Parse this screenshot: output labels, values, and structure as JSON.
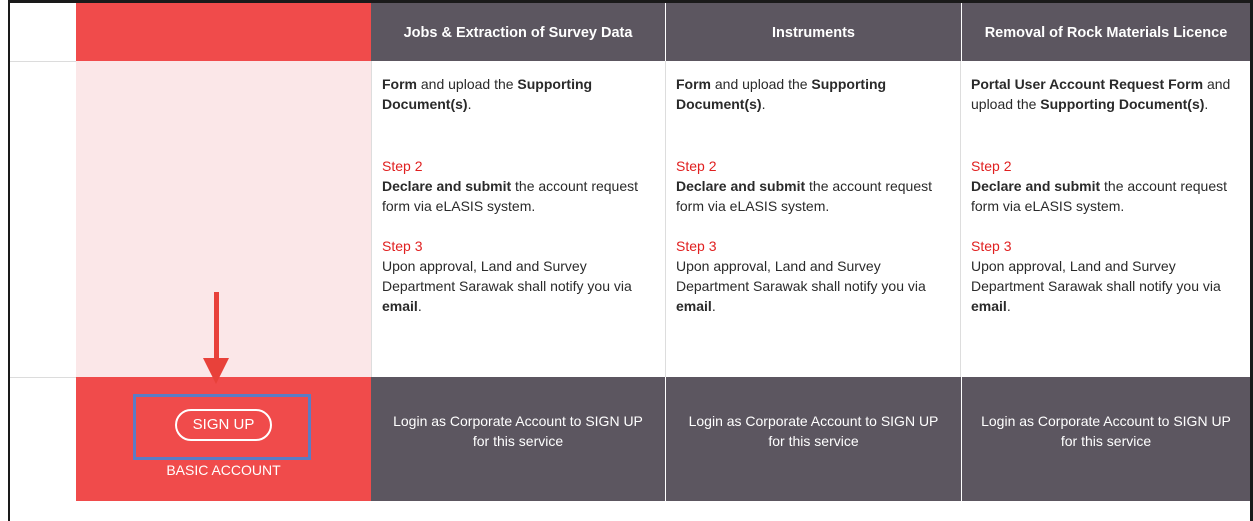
{
  "columns": [
    {
      "header_partial": "",
      "header": "Jobs & Extraction of Survey Data",
      "body_partial": "",
      "form_bold": "Form",
      "form_text1": " and upload the ",
      "form_bold2": "Supporting Document(s)",
      "form_text2": ".",
      "step2_title": "Step 2",
      "step2_bold": "Declare and submit",
      "step2_text": " the account request form via eLASIS system.",
      "step3_title": "Step 3",
      "step3_text": "Upon approval, Land and Survey Department Sarawak shall notify you via ",
      "step3_bold": "email",
      "step3_end": ".",
      "footer": "Login as Corporate Account to SIGN UP for this service"
    },
    {
      "header_partial": "",
      "header": "Instruments",
      "body_partial": "",
      "form_bold": "Form",
      "form_text1": " and upload the ",
      "form_bold2": "Supporting Document(s)",
      "form_text2": ".",
      "step2_title": "Step 2",
      "step2_bold": "Declare and submit",
      "step2_text": " the account request form via eLASIS system.",
      "step3_title": "Step 3",
      "step3_text": "Upon approval, Land and Survey Department Sarawak shall notify you via ",
      "step3_bold": "email",
      "step3_end": ".",
      "footer": "Login as Corporate Account to SIGN UP for this service"
    },
    {
      "header_partial": "",
      "header": "Removal of Rock Materials Licence",
      "body_partial": "",
      "form_bold": "Portal User Account Request Form",
      "form_text1": " and upload the ",
      "form_bold2": "Supporting Document(s)",
      "form_text2": ".",
      "step2_title": "Step 2",
      "step2_bold": "Declare and submit",
      "step2_text": " the account request form via eLASIS system.",
      "step3_title": "Step 3",
      "step3_text": "Upon approval, Land and Survey Department Sarawak shall notify you via ",
      "step3_bold": "email",
      "step3_end": ".",
      "footer": "Login as Corporate Account to SIGN UP for this service"
    }
  ],
  "basic": {
    "signup_label": "SIGN UP",
    "account_label": "BASIC ACCOUNT"
  },
  "colors": {
    "red": "#f04b4b",
    "pink": "#fbe7e8",
    "dark": "#5c5660",
    "step_red": "#e02020",
    "highlight_blue": "#5b7cc4",
    "arrow": "#e8413a"
  },
  "annotation_icons": [
    "down-arrow-icon"
  ]
}
